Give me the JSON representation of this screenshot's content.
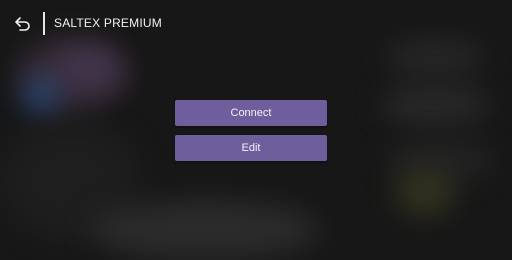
{
  "header": {
    "back_icon": "back-arrow-icon",
    "title": "SALTEX PREMIUM"
  },
  "actions": {
    "connect_label": "Connect",
    "edit_label": "Edit"
  },
  "colors": {
    "button_background": "#6e5e9b",
    "screen_background": "#171717",
    "text": "#f2f2f2"
  }
}
